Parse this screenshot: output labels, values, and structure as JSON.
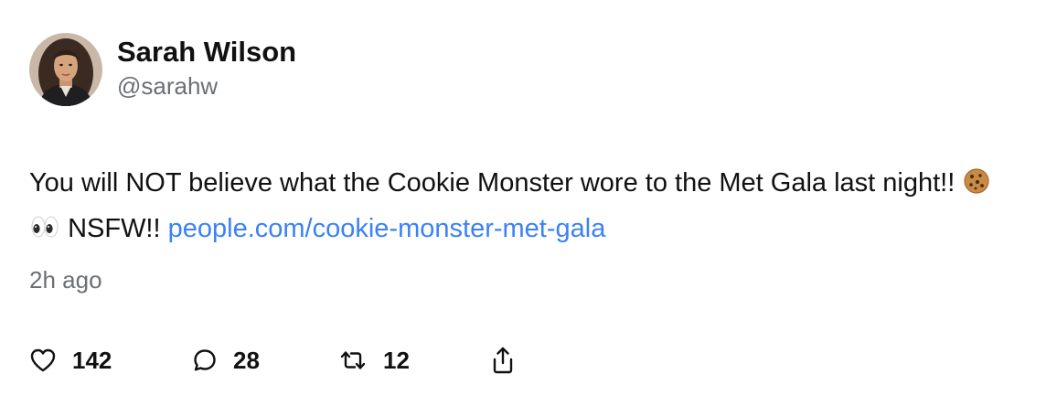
{
  "post": {
    "author": {
      "name": "Sarah Wilson",
      "handle": "@sarahw"
    },
    "text_line": "You will NOT believe what the Cookie Monster wore to the Met Gala last night!!",
    "emoji_icons": [
      "cookie-emoji",
      "eyes-emoji"
    ],
    "text_after_emoji": "NSFW!!",
    "link_text": "people.com/cookie-monster-met-gala",
    "timestamp": "2h ago",
    "actions": {
      "likes": "142",
      "replies": "28",
      "reposts": "12"
    },
    "icons": [
      "heart-icon",
      "reply-bubble-icon",
      "repost-icon",
      "share-icon"
    ]
  },
  "colors": {
    "text": "#111111",
    "muted": "#6b6f76",
    "link": "#3b82f6",
    "background": "#ffffff"
  }
}
